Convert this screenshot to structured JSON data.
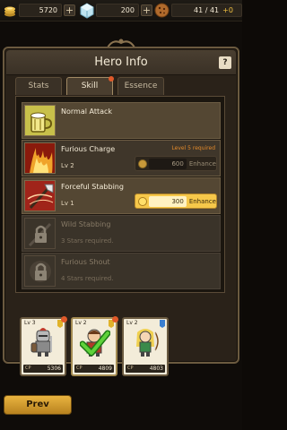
{
  "resources": {
    "gold": "5720",
    "gems": "200",
    "stamina": "41 / 41",
    "stamina_bonus": "+0",
    "plus_label": "+"
  },
  "window": {
    "title": "Hero Info",
    "help_label": "?"
  },
  "tabs": [
    {
      "label": "Stats",
      "active": false
    },
    {
      "label": "Skill",
      "active": true
    },
    {
      "label": "Essence",
      "active": false
    }
  ],
  "skills": [
    {
      "name": "Normal Attack",
      "level": "",
      "requirement": "",
      "cost": "",
      "enhance_label": "",
      "locked": false
    },
    {
      "name": "Furious Charge",
      "level": "Lv 2",
      "requirement": "Level 5 required",
      "cost": "600",
      "enhance_label": "Enhance",
      "locked": false
    },
    {
      "name": "Forceful Stabbing",
      "level": "Lv 1",
      "requirement": "",
      "cost": "300",
      "enhance_label": "Enhance",
      "locked": false
    },
    {
      "name": "Wild Stabbing",
      "level": "3 Stars required.",
      "requirement": "",
      "cost": "",
      "enhance_label": "",
      "locked": true
    },
    {
      "name": "Furious Shout",
      "level": "4 Stars required.",
      "requirement": "",
      "cost": "",
      "enhance_label": "",
      "locked": true
    }
  ],
  "heroes": [
    {
      "level": "Lv 3",
      "cp_label": "CP",
      "cp": "5306"
    },
    {
      "level": "Lv 2",
      "cp_label": "CP",
      "cp": "4809"
    },
    {
      "level": "Lv 2",
      "cp_label": "CP",
      "cp": "4803"
    }
  ],
  "nav": {
    "prev_label": "Prev"
  },
  "colors": {
    "accent_gold": "#f6c84a",
    "requirement_orange": "#e38a2a",
    "notification_red": "#e05a2a"
  }
}
